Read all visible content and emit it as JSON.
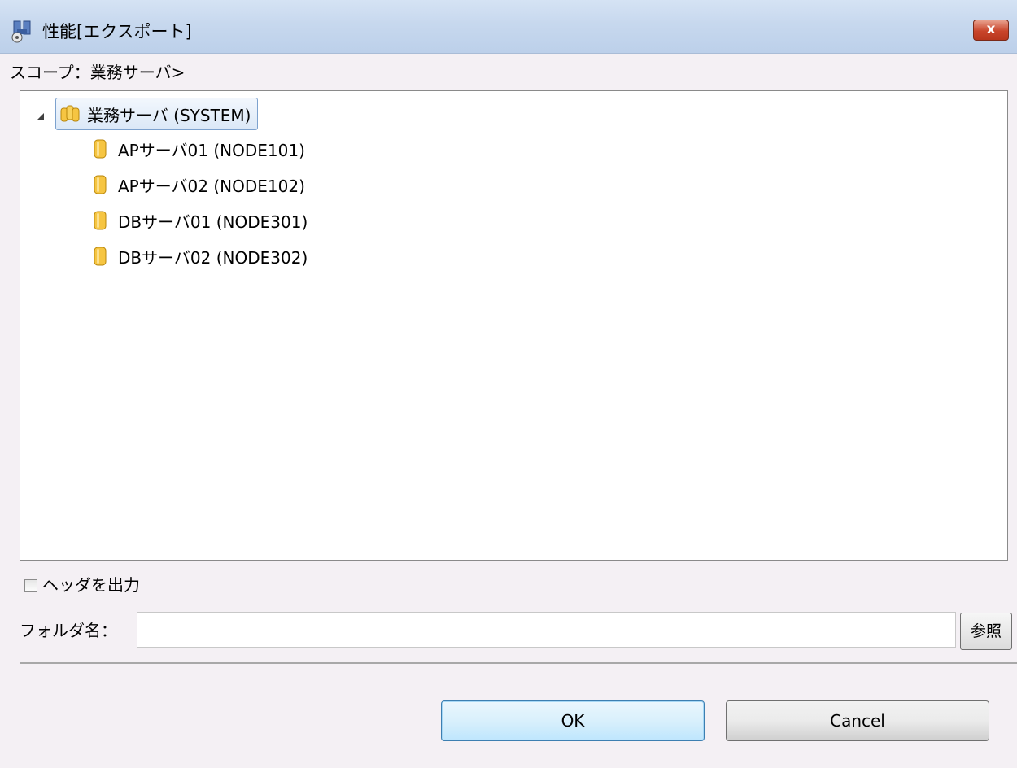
{
  "window": {
    "title": "性能[エクスポート]",
    "close_label": "x",
    "close_color": "#c9452b"
  },
  "scope": {
    "label": "スコープ：業務サーバ>"
  },
  "tree": {
    "root": {
      "label": "業務サーバ (SYSTEM)",
      "icon": "scope-folder-icon",
      "expanded": true,
      "selected": true
    },
    "children": [
      {
        "label": "APサーバ01 (NODE101)",
        "icon": "node-icon"
      },
      {
        "label": "APサーバ02 (NODE102)",
        "icon": "node-icon"
      },
      {
        "label": "DBサーバ01 (NODE301)",
        "icon": "node-icon"
      },
      {
        "label": "DBサーバ02 (NODE302)",
        "icon": "node-icon"
      }
    ]
  },
  "header_option": {
    "label": "ヘッダを出力",
    "checked": false
  },
  "folder": {
    "label": "フォルダ名：",
    "value": "",
    "browse_label": "参照"
  },
  "buttons": {
    "ok_label": "OK",
    "cancel_label": "Cancel"
  }
}
